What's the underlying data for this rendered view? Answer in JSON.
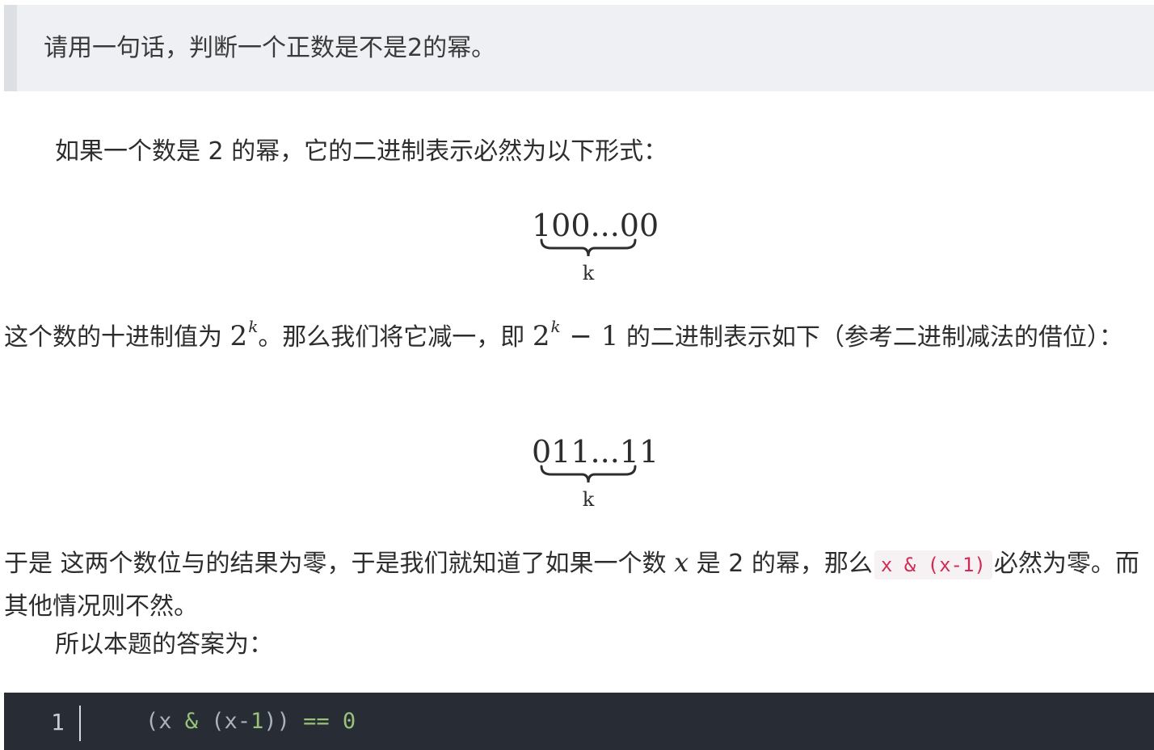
{
  "quote": {
    "text": "请用一句话，判断一个正数是不是2的幂。"
  },
  "intro": {
    "text": "如果一个数是 2 的幂，它的二进制表示必然为以下形式："
  },
  "binary_power": {
    "digits": "100...00",
    "label": "k"
  },
  "decimal_para": {
    "part1": "这个数的十进制值为 ",
    "base1": "2",
    "exp1": "k",
    "part2": "。那么我们将它减一，即 ",
    "base2": "2",
    "exp2": "k",
    "minus_one": " − 1",
    "part3": " 的二进制表示如下（参考二进制减法的借位）："
  },
  "binary_minus_one": {
    "digits": "011...11",
    "label": "k"
  },
  "result_para": {
    "part1": "于是 这两个数位与的结果为零，于是我们就知道了如果一个数 ",
    "var_x": "x",
    "part2": " 是 2 的幂，那么",
    "code": "x & (x-1)",
    "part3": "必然为零。而其他情况则不然。"
  },
  "answer": {
    "text": "所以本题的答案为："
  },
  "code_block": {
    "line_number": "1",
    "tokens": {
      "open": "(x ",
      "amp": "&",
      "mid": " (x-",
      "one": "1",
      "close": ")) ",
      "eq": "==",
      "space": " ",
      "zero": "0"
    }
  }
}
